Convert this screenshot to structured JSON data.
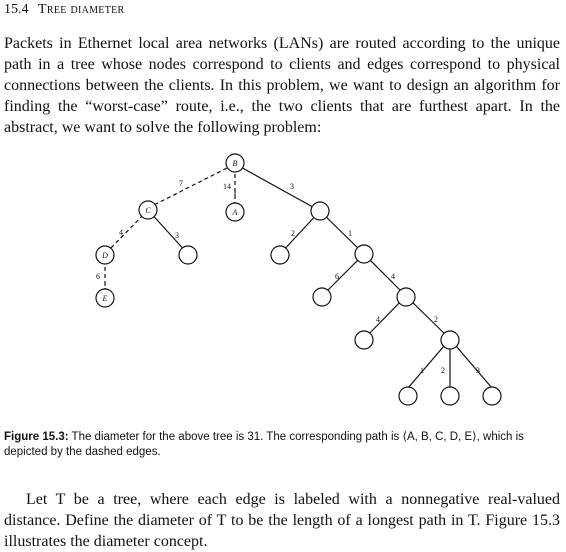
{
  "header": {
    "number": "15.4",
    "title": "Tree diameter"
  },
  "intro_paragraph": "Packets in Ethernet local area networks (LANs) are routed according to the unique path in a tree whose nodes correspond to clients and edges correspond to physical connections between the clients. In this problem, we want to design an algorithm for finding the “worst-case” route, i.e., the two clients that are furthest apart. In the abstract, we want to solve the following problem:",
  "figure": {
    "node_labels": [
      "B",
      "C",
      "A",
      "D",
      "E"
    ],
    "edge_labels": [
      "7",
      "14",
      "3",
      "4",
      "3",
      "2",
      "1",
      "6",
      "6",
      "4",
      "4",
      "2",
      "1",
      "2",
      "3"
    ],
    "caption_label": "Figure 15.3:",
    "caption_text": " The diameter for the above tree is 31. The corresponding path is ⟨A, B, C, D, E⟩, which is depicted by the dashed edges."
  },
  "body_paragraph": "Let T be a tree, where each edge is labeled with a nonnegative real-valued distance. Define the diameter of T to be the length of a longest path in T. Figure 15.3 illustrates the diameter concept."
}
